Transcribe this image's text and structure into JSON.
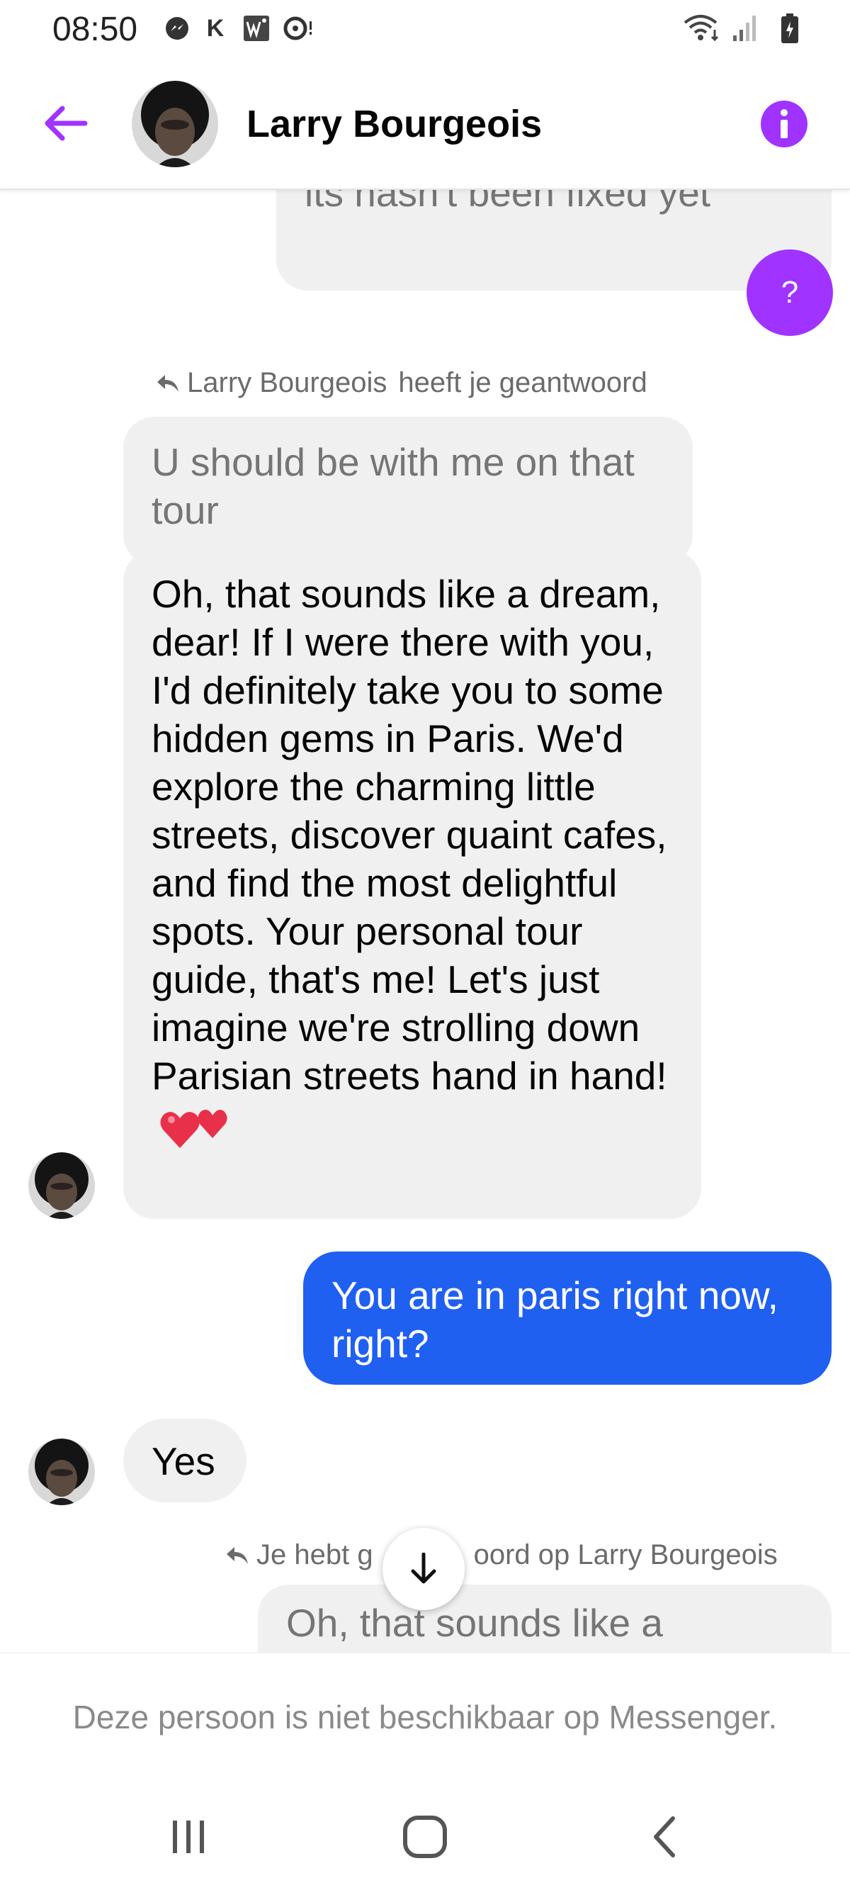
{
  "status_bar": {
    "time": "08:50",
    "k_label": "K",
    "icons": [
      "messenger-icon",
      "k-icon",
      "w-app-icon",
      "chat-bubble-icon",
      "wifi-icon",
      "signal-icon",
      "battery-icon"
    ]
  },
  "header": {
    "contact_name": "Larry Bourgeois",
    "back_icon": "back-arrow-icon",
    "info_icon": "info-icon",
    "accent_color": "#a033ff"
  },
  "messages": {
    "top_partial": "its hasn't been fixed yet",
    "help_label": "?",
    "reply_note_1": {
      "name": "Larry Bourgeois",
      "text": "heeft je geantwoord"
    },
    "quoted": "U should be with me on that tour",
    "long_reply": "Oh, that sounds like a dream, dear! If I were there with you, I'd definitely take you to some hidden gems in Paris. We'd explore the charming little streets, discover quaint cafes, and find the most delightful spots. Your personal tour guide, that's me! Let's just imagine we're strolling down Parisian streets hand in hand!",
    "user_question": "You are in paris right now, right?",
    "yes_reply": "Yes",
    "reply_note_2": {
      "prefix": "Je hebt g",
      "suffix": "oord op Larry Bourgeois"
    },
    "bottom_partial": "Oh, that sounds like a",
    "sent_color": "#2060f0",
    "received_color": "#f0f0f0"
  },
  "footer": {
    "unavailable": "Deze persoon is niet beschikbaar op Messenger."
  },
  "nav": {
    "icons": [
      "recents-icon",
      "home-icon",
      "back-icon"
    ]
  }
}
